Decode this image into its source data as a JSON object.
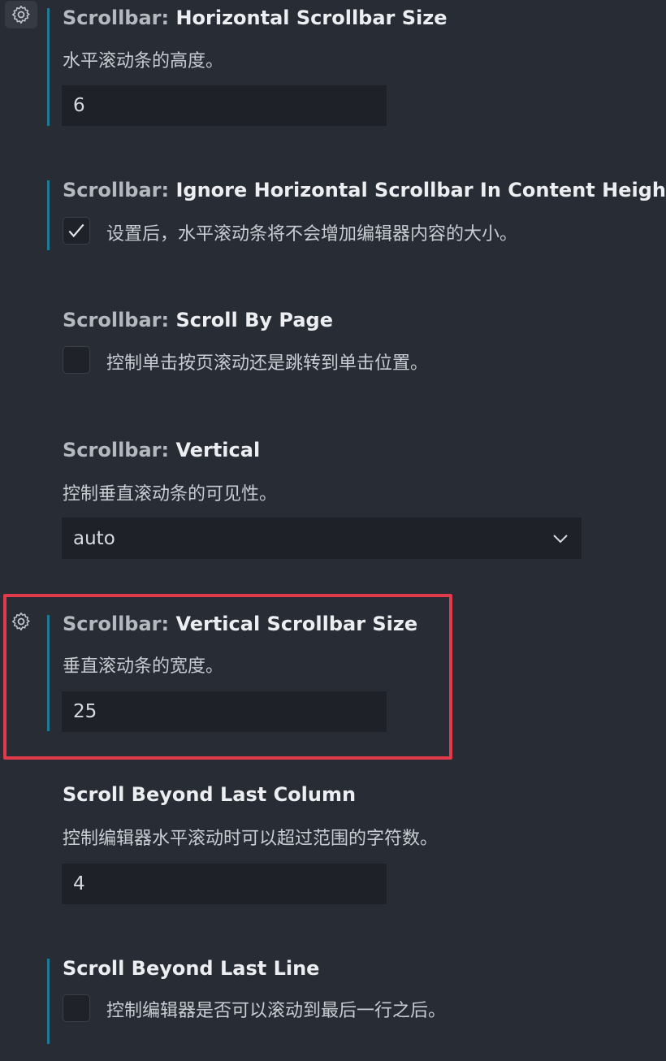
{
  "settings": [
    {
      "category": "Scrollbar: ",
      "name": "Horizontal Scrollbar Size",
      "description": "水平滚动条的高度。",
      "value": "6"
    },
    {
      "category": "Scrollbar: ",
      "name": "Ignore Horizontal Scrollbar In Content Height",
      "description": "设置后，水平滚动条将不会增加编辑器内容的大小。",
      "checked": true
    },
    {
      "category": "Scrollbar: ",
      "name": "Scroll By Page",
      "description": "控制单击按页滚动还是跳转到单击位置。",
      "checked": false
    },
    {
      "category": "Scrollbar: ",
      "name": "Vertical",
      "description": "控制垂直滚动条的可见性。",
      "selected": "auto"
    },
    {
      "category": "Scrollbar: ",
      "name": "Vertical Scrollbar Size",
      "description": "垂直滚动条的宽度。",
      "value": "25"
    },
    {
      "category": "",
      "name": "Scroll Beyond Last Column",
      "description": "控制编辑器水平滚动时可以超过范围的字符数。",
      "value": "4"
    },
    {
      "category": "",
      "name": "Scroll Beyond Last Line",
      "description": "控制编辑器是否可以滚动到最后一行之后。",
      "checked": false
    }
  ],
  "colors": {
    "background": "#282c34",
    "modified_indicator": "#1f7a95",
    "highlight": "#e23a4a",
    "input_background": "#1e2127"
  },
  "icons": {
    "gear": "gear-icon",
    "check": "check-icon",
    "dropdown": "chevron-down-icon"
  }
}
